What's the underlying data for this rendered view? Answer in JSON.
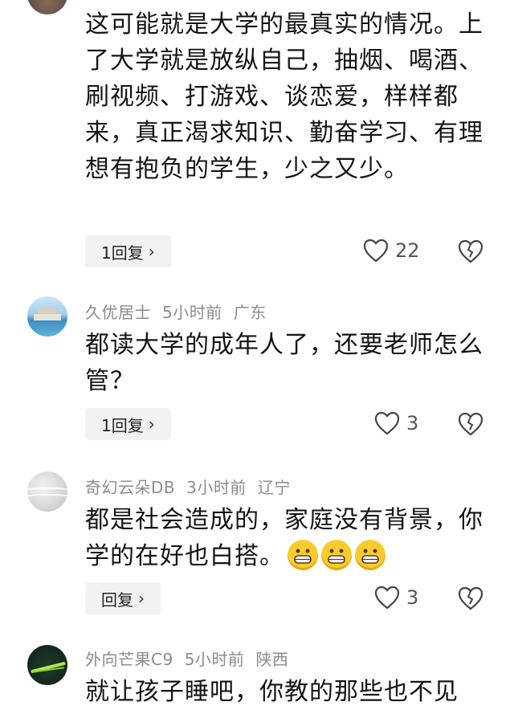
{
  "comments": [
    {
      "text": "这可能就是大学的最真实的情况。上了大学就是放纵自己，抽烟、喝酒、刷视频、打游戏、谈恋爱，样样都来，真正渴求知识、勤奋学习、有理想有抱负的学生，少之又少。",
      "reply_label": "1回复",
      "likes": "22"
    },
    {
      "user": "久优居士",
      "time": "5小时前",
      "location": "广东",
      "text": "都读大学的成年人了，还要老师怎么管？",
      "reply_label": "1回复",
      "likes": "3"
    },
    {
      "user": "奇幻云朵DB",
      "time": "3小时前",
      "location": "辽宁",
      "text": "都是社会造成的，家庭没有背景，你学的在好也白搭。",
      "reply_label": "回复",
      "likes": "3"
    },
    {
      "user": "外向芒果C9",
      "time": "5小时前",
      "location": "陕西",
      "text": "就让孩子睡吧，你教的那些也不见"
    }
  ],
  "icons": {
    "like": "heart-outline-icon",
    "dislike": "broken-heart-icon",
    "reply_chevron": "chevron-right-icon",
    "emoji": "grinning-face-emoji"
  },
  "colors": {
    "meta": "#8c8c8c",
    "reply_bg": "#f2f2f2",
    "emoji": "#f9cc2e"
  }
}
